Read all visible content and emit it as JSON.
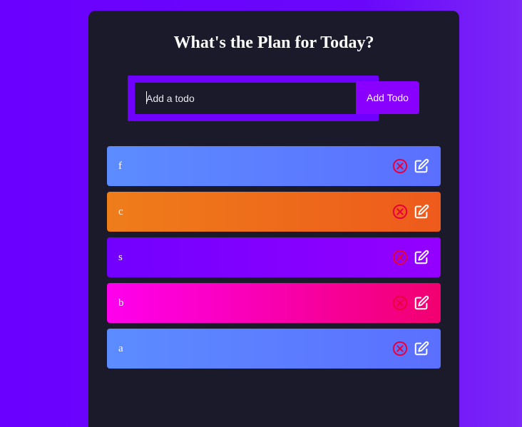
{
  "header": {
    "title": "What's the Plan for Today?"
  },
  "form": {
    "input_value": "",
    "placeholder": "Add a todo",
    "button_label": "Add Todo"
  },
  "todos": [
    {
      "text": "f"
    },
    {
      "text": "c"
    },
    {
      "text": "s"
    },
    {
      "text": "b"
    },
    {
      "text": "a"
    }
  ],
  "icons": {
    "delete": "close-circle-icon",
    "edit": "edit-icon"
  },
  "colors": {
    "background": "#6a00ff",
    "panel": "#1b1a2b",
    "accent": "#8a00ff",
    "delete_icon": "#e8003a"
  }
}
